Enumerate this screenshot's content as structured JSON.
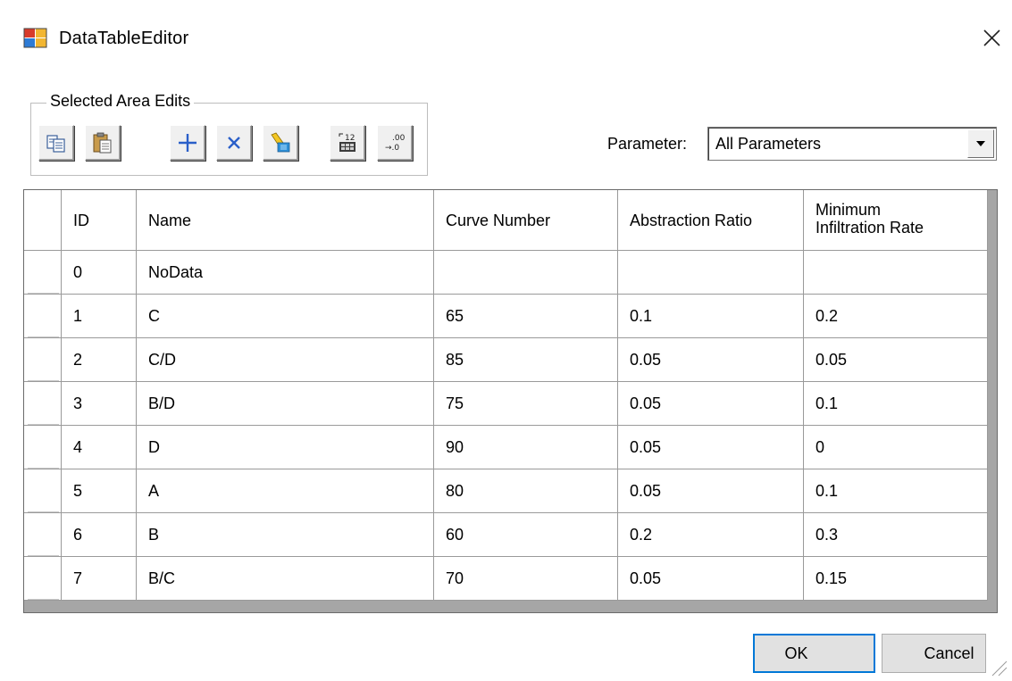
{
  "window": {
    "title": "DataTableEditor",
    "close_glyph": "✕"
  },
  "toolbar": {
    "group_label": "Selected Area Edits",
    "buttons": [
      {
        "icon": "copy-icon"
      },
      {
        "icon": "paste-icon"
      },
      {
        "icon": "add-row-icon"
      },
      {
        "icon": "delete-row-icon"
      },
      {
        "icon": "fill-icon"
      },
      {
        "icon": "calculator-icon"
      },
      {
        "icon": "decimal-places-icon"
      }
    ],
    "decimal_top": ".00",
    "decimal_bottom": "→.0",
    "calc_label": "12"
  },
  "parameter": {
    "label": "Parameter:",
    "selected": "All Parameters"
  },
  "table": {
    "headers": {
      "id": "ID",
      "name": "Name",
      "curve_number": "Curve Number",
      "abstraction_ratio": "Abstraction Ratio",
      "min_infiltration_line1": "Minimum",
      "min_infiltration_line2": "Infiltration Rate"
    },
    "rows": [
      {
        "id": "0",
        "name": "NoData",
        "cn": "",
        "ar": "",
        "mir": ""
      },
      {
        "id": "1",
        "name": "C",
        "cn": "65",
        "ar": "0.1",
        "mir": "0.2"
      },
      {
        "id": "2",
        "name": "C/D",
        "cn": "85",
        "ar": "0.05",
        "mir": "0.05"
      },
      {
        "id": "3",
        "name": "B/D",
        "cn": "75",
        "ar": "0.05",
        "mir": "0.1"
      },
      {
        "id": "4",
        "name": "D",
        "cn": "90",
        "ar": "0.05",
        "mir": "0"
      },
      {
        "id": "5",
        "name": "A",
        "cn": "80",
        "ar": "0.05",
        "mir": "0.1"
      },
      {
        "id": "6",
        "name": "B",
        "cn": "60",
        "ar": "0.2",
        "mir": "0.3"
      },
      {
        "id": "7",
        "name": "B/C",
        "cn": "70",
        "ar": "0.05",
        "mir": "0.15"
      }
    ]
  },
  "dialog_buttons": {
    "ok": "OK",
    "cancel": "Cancel"
  },
  "colors": {
    "accent": "#0078d7",
    "grid_background": "#a6a6a6"
  }
}
